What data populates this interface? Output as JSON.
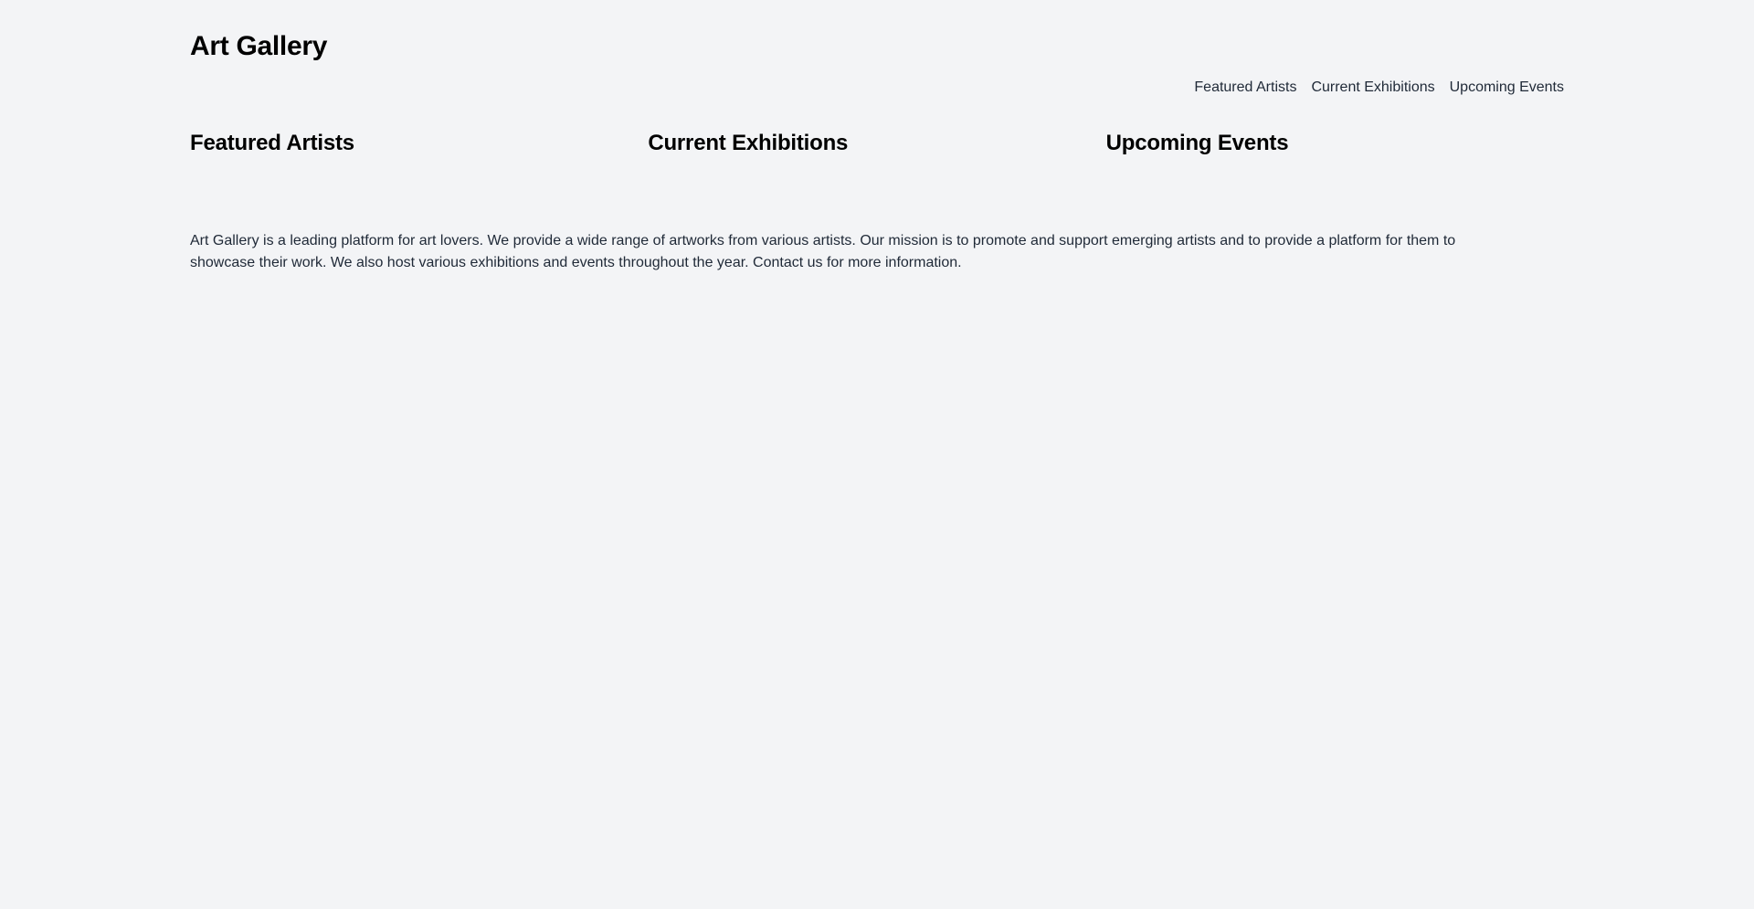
{
  "header": {
    "title": "Art Gallery",
    "nav": [
      {
        "label": "Featured Artists"
      },
      {
        "label": "Current Exhibitions"
      },
      {
        "label": "Upcoming Events"
      }
    ]
  },
  "sections": [
    {
      "heading": "Featured Artists"
    },
    {
      "heading": "Current Exhibitions"
    },
    {
      "heading": "Upcoming Events"
    }
  ],
  "about": {
    "text": "Art Gallery is a leading platform for art lovers. We provide a wide range of artworks from various artists. Our mission is to promote and support emerging artists and to provide a platform for them to showcase their work. We also host various exhibitions and events throughout the year. Contact us for more information."
  },
  "colors": {
    "background": "#f3f4f6",
    "text_primary": "#000000",
    "text_secondary": "#1f2937"
  }
}
